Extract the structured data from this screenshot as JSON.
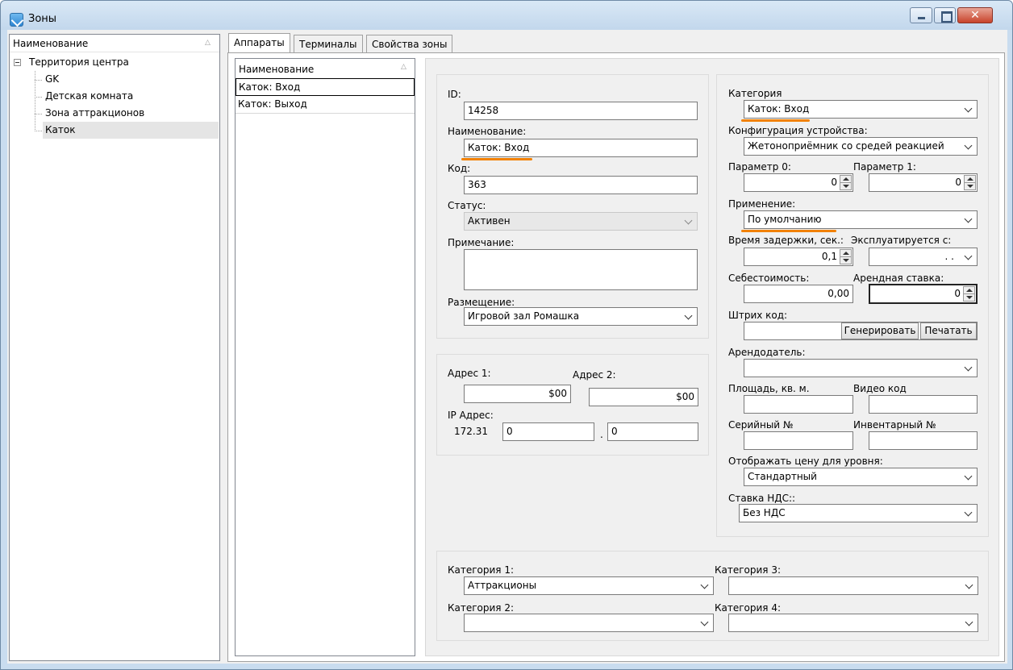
{
  "window": {
    "title": "Зоны"
  },
  "tree": {
    "header": "Наименование",
    "root": "Территория центра",
    "children": [
      "GK",
      "Детская комната",
      "Зона аттракционов",
      "Каток"
    ]
  },
  "tabs": [
    "Аппараты",
    "Терминалы",
    "Свойства зоны"
  ],
  "devices": {
    "header": "Наименование",
    "items": [
      "Каток: Вход",
      "Каток: Выход"
    ]
  },
  "form": {
    "id_label": "ID:",
    "id_value": "14258",
    "name_label": "Наименование:",
    "name_value": "Каток: Вход",
    "code_label": "Код:",
    "code_value": "363",
    "status_label": "Статус:",
    "status_value": "Активен",
    "note_label": "Примечание:",
    "placement_label": "Размещение:",
    "placement_value": "Игровой зал Ромашка",
    "addr1_label": "Адрес 1:",
    "addr1_value": "$00",
    "addr2_label": "Адрес 2:",
    "addr2_value": "$00",
    "ip_label": "IP Адрес:",
    "ip_prefix": "172.31",
    "ip_part3": "0",
    "ip_dot": ".",
    "ip_part4": "0",
    "category_label": "Категория",
    "category_value": "Каток: Вход",
    "config_label": "Конфигурация устройства:",
    "config_value": "Жетоноприёмник со средей реакцией",
    "param0_label": "Параметр 0:",
    "param0_value": "0",
    "param1_label": "Параметр 1:",
    "param1_value": "0",
    "usage_label": "Применение:",
    "usage_value": "По умолчанию",
    "delay_label": "Время задержки, сек.:",
    "delay_value": "0,1",
    "inuse_label": "Эксплуатируется с:",
    "inuse_value": ". .",
    "cost_label": "Себестоимость:",
    "cost_value": "0,00",
    "rent_label": "Арендная ставка:",
    "rent_value": "0",
    "barcode_label": "Штрих код:",
    "generate_button": "Генерировать",
    "print_button": "Печатать",
    "landlord_label": "Арендодатель:",
    "area_label": "Площадь, кв. м.",
    "video_label": "Видео код",
    "serial_label": "Серийный №",
    "inventory_label": "Инвентарный №",
    "price_level_label": "Отображать цену для уровня:",
    "price_level_value": "Стандартный",
    "vat_label": "Ставка НДС::",
    "vat_value": "Без НДС",
    "cat1_label": "Категория 1:",
    "cat1_value": "Аттракционы",
    "cat2_label": "Категория 2:",
    "cat3_label": "Категория 3:",
    "cat4_label": "Категория 4:"
  },
  "colors": {
    "highlight": "#f28100"
  }
}
